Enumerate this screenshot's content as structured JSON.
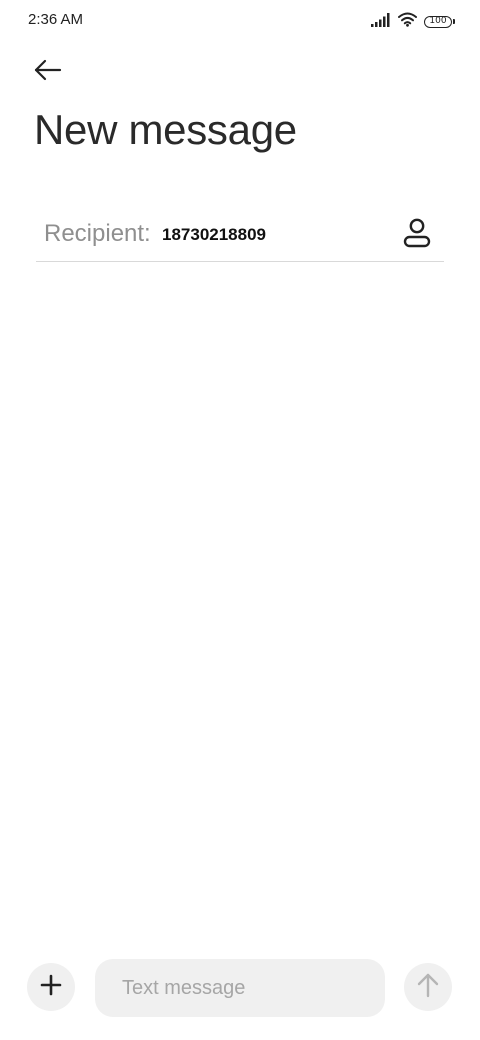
{
  "status_bar": {
    "time": "2:36 AM",
    "battery_level": "100",
    "icons": [
      "signal-icon",
      "wifi-icon",
      "battery-icon"
    ]
  },
  "header": {
    "back_icon": "arrow-left-icon",
    "title": "New message"
  },
  "recipient": {
    "label": "Recipient:",
    "value": "18730218809",
    "contact_icon": "person-icon"
  },
  "compose": {
    "attach_icon": "plus-icon",
    "placeholder": "Text message",
    "value": "",
    "send_icon": "arrow-up-icon"
  },
  "colors": {
    "background": "#ffffff",
    "input_bg": "#f0f0f0",
    "label_gray": "#8f8f8f",
    "divider": "#d9d9d9",
    "send_disabled": "#b5b5b5"
  }
}
